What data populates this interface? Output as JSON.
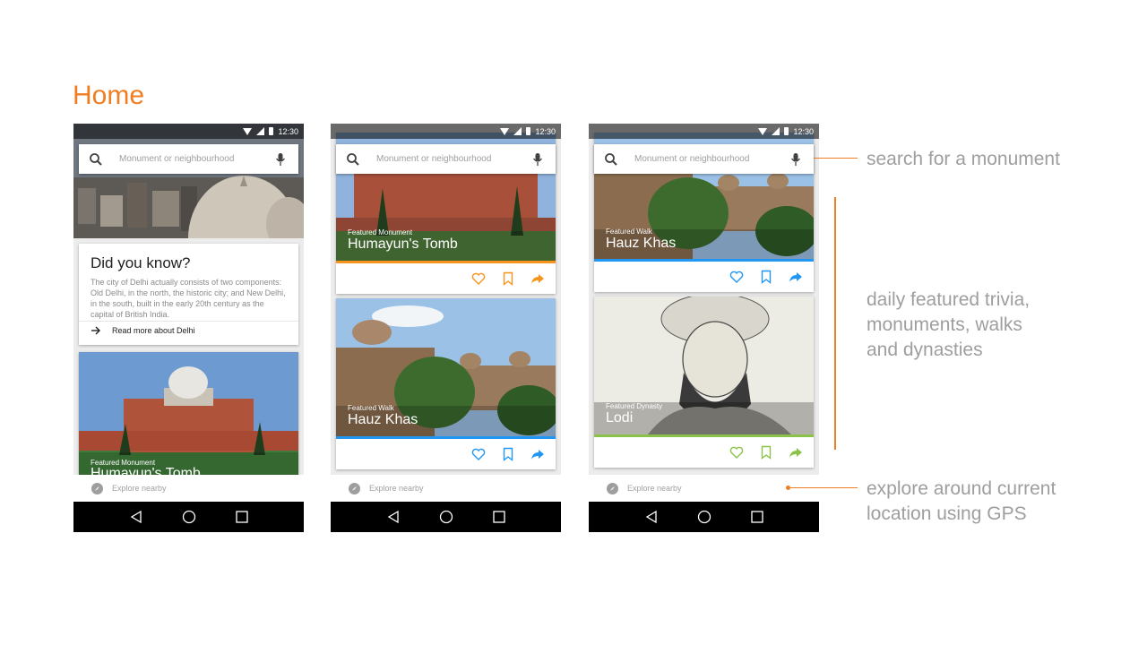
{
  "page": {
    "title": "Home"
  },
  "status": {
    "time": "12:30"
  },
  "search": {
    "placeholder": "Monument or neighbourhood"
  },
  "trivia": {
    "title": "Did you know?",
    "body": "The city of Delhi actually consists of two components: Old Delhi, in the north, the historic city; and New Delhi, in the south, built in the early 20th century as the capital of British India.",
    "link": "Read more about Delhi"
  },
  "cards": {
    "humayun": {
      "kicker": "Featured Monument",
      "title": "Humayun's Tomb",
      "accent": "#f7941d"
    },
    "hauz": {
      "kicker": "Featured Walk",
      "title": "Hauz Khas",
      "accent": "#2196f3"
    },
    "lodi": {
      "kicker": "Featured Dynasty",
      "title": "Lodi",
      "accent": "#8bc34a"
    }
  },
  "explore": {
    "label": "Explore nearby"
  },
  "annotations": {
    "search": "search for a monument",
    "featured": [
      "daily featured trivia,",
      "monuments, walks",
      "and dynasties"
    ],
    "explore": [
      "explore around current",
      "location using GPS"
    ]
  },
  "icons": [
    "search-icon",
    "mic-icon",
    "heart-icon",
    "bookmark-icon",
    "share-icon",
    "compass-icon",
    "back-icon",
    "home-icon",
    "recents-icon",
    "arrow-right-icon"
  ],
  "colors": {
    "accent": "#ef7d22",
    "annotation_text": "#9e9e9e"
  }
}
